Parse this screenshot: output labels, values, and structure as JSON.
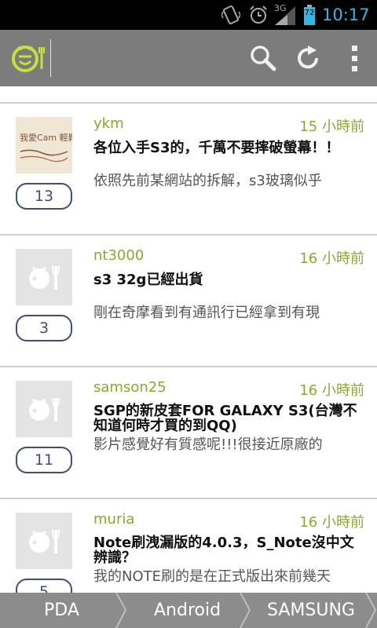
{
  "status_bar": {
    "time": "10:17",
    "network": "3G",
    "battery": "72",
    "icons": [
      "vibrate-icon",
      "alarm-icon",
      "signal-icon",
      "battery-icon"
    ]
  },
  "action_bar": {
    "icons": [
      "app-logo-icon",
      "search-icon",
      "refresh-icon",
      "overflow-menu-icon"
    ]
  },
  "posts": [
    {
      "author": "ykm",
      "time": "15 小時前",
      "title": "各位入手S3的，千萬不要摔破螢幕！！",
      "excerpt": "依照先前某網站的拆解，s3玻璃似乎",
      "replies": "13",
      "thumb_text": "我愛Cam 輕鬆聊!"
    },
    {
      "author": "nt3000",
      "time": "16 小時前",
      "title": "s3 32g已經出貨",
      "excerpt": "剛在奇摩看到有通訊行已經拿到有現",
      "replies": "3"
    },
    {
      "author": "samson25",
      "time": "16 小時前",
      "title": "SGP的新皮套FOR GALAXY S3(台灣不知道何時才買的到QQ)",
      "excerpt": "影片感覺好有質感呢!!!很接近原廠的",
      "replies": "11"
    },
    {
      "author": "muria",
      "time": "16 小時前",
      "title": "Note刷洩漏版的4.0.3，S_Note沒中文辨識？",
      "excerpt": "我的NOTE刷的是在正式版出來前幾天",
      "replies": "5"
    }
  ],
  "breadcrumb": [
    "PDA",
    "Android",
    "SAMSUNG"
  ],
  "colors": {
    "accent_green": "#87a92e",
    "badge_blue": "#3f4e77",
    "clock_blue": "#33b5e5",
    "actionbar_gray": "#7c7c7c"
  }
}
